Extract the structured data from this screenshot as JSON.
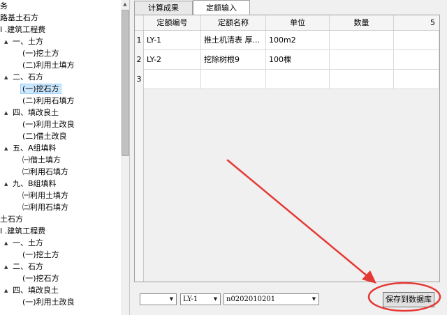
{
  "tree": {
    "items": [
      {
        "label": "务",
        "level": 0,
        "toggle": ""
      },
      {
        "label": "路基土石方",
        "level": 0,
        "toggle": ""
      },
      {
        "label": "I .建筑工程费",
        "level": 0,
        "toggle": ""
      },
      {
        "label": "一、土方",
        "level": 1,
        "toggle": "▲"
      },
      {
        "label": "(一)挖土方",
        "level": 2,
        "toggle": ""
      },
      {
        "label": "(二)利用土填方",
        "level": 2,
        "toggle": ""
      },
      {
        "label": "二、石方",
        "level": 1,
        "toggle": "▲"
      },
      {
        "label": "(一)挖石方",
        "level": 2,
        "toggle": "",
        "selected": true
      },
      {
        "label": "(二)利用石填方",
        "level": 2,
        "toggle": ""
      },
      {
        "label": "四、填改良土",
        "level": 1,
        "toggle": "▲"
      },
      {
        "label": "(一)利用土改良",
        "level": 2,
        "toggle": ""
      },
      {
        "label": "(二)借土改良",
        "level": 2,
        "toggle": ""
      },
      {
        "label": "五、A组填料",
        "level": 1,
        "toggle": "▲"
      },
      {
        "label": "㈠借土填方",
        "level": 2,
        "toggle": ""
      },
      {
        "label": "㈡利用石填方",
        "level": 2,
        "toggle": ""
      },
      {
        "label": "九、B组填料",
        "level": 1,
        "toggle": "▲"
      },
      {
        "label": "㈠利用土填方",
        "level": 2,
        "toggle": ""
      },
      {
        "label": "㈡利用石填方",
        "level": 2,
        "toggle": ""
      },
      {
        "label": "土石方",
        "level": 0,
        "toggle": ""
      },
      {
        "label": "I .建筑工程费",
        "level": 0,
        "toggle": ""
      },
      {
        "label": "一、土方",
        "level": 1,
        "toggle": "▲"
      },
      {
        "label": "(一)挖土方",
        "level": 2,
        "toggle": ""
      },
      {
        "label": "二、石方",
        "level": 1,
        "toggle": "▲"
      },
      {
        "label": "(一)挖石方",
        "level": 2,
        "toggle": ""
      },
      {
        "label": "四、填改良土",
        "level": 1,
        "toggle": "▲"
      },
      {
        "label": "(一)利用土改良",
        "level": 2,
        "toggle": ""
      }
    ],
    "scroll_up_icon": "▲"
  },
  "tabs": [
    {
      "label": "计算成果",
      "active": false
    },
    {
      "label": "定额输入",
      "active": true
    }
  ],
  "grid": {
    "columns": [
      "",
      "定额编号",
      "定额名称",
      "单位",
      "数量",
      "5"
    ],
    "rows": [
      {
        "num": "1",
        "code": "LY-1",
        "name": "推土机清表 厚...",
        "unit": "100m2",
        "qty": ""
      },
      {
        "num": "2",
        "code": "LY-2",
        "name": "挖除树根9",
        "unit": "100棵",
        "qty": ""
      },
      {
        "num": "3",
        "code": "",
        "name": "",
        "unit": "",
        "qty": ""
      }
    ]
  },
  "bottom": {
    "combo1_value": "",
    "combo2_value": "LY-1",
    "combo3_value": "n0202010201",
    "arrow_icon": "▼",
    "save_label": "保存到数据库"
  },
  "colors": {
    "selection": "#cce8ff",
    "annotation_red": "#e53935"
  }
}
